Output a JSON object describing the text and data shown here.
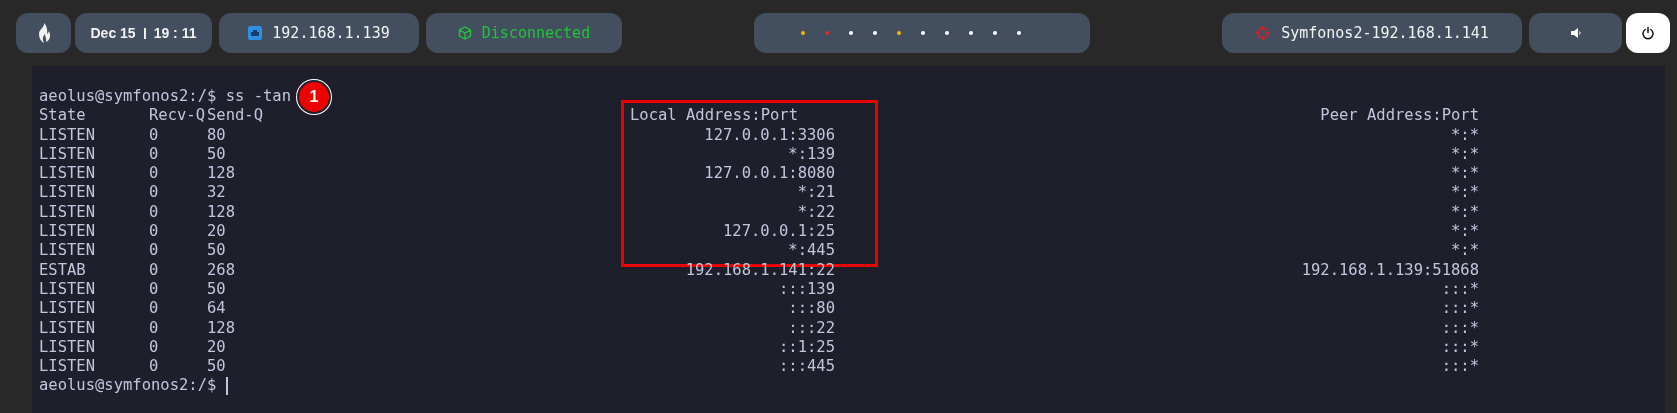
{
  "top_bar": {
    "date": "Dec 15",
    "time": "19 : 11",
    "ip": "192.168.1.139",
    "vpn_status": "Disconnected",
    "workspaces": [
      {
        "color": "#f5b800"
      },
      {
        "color": "#e8262a"
      },
      {
        "color": "#ffffff"
      },
      {
        "color": "#ffffff"
      },
      {
        "color": "#f5b800"
      },
      {
        "color": "#ffffff"
      },
      {
        "color": "#ffffff"
      },
      {
        "color": "#ffffff"
      },
      {
        "color": "#ffffff"
      },
      {
        "color": "#ffffff"
      }
    ],
    "target": "Symfonos2-192.168.1.141"
  },
  "terminal": {
    "prompt": "aeolus@symfonos2:/$ ss -tan",
    "step_badge": "1",
    "header": {
      "state": "State",
      "recv_q": "Recv-Q",
      "send_q": "Send-Q",
      "peer": "Peer Address:Port"
    },
    "local_column": {
      "boxed": [
        "Local Address:Port",
        "127.0.0.1:3306",
        "*:139",
        "127.0.0.1:8080",
        "*:21",
        "*:22",
        "127.0.0.1:25",
        "*:445"
      ],
      "unboxed": [
        "192.168.1.141:22",
        ":::139",
        ":::80",
        ":::22",
        "::1:25",
        ":::445"
      ]
    },
    "rows": [
      {
        "state": "LISTEN",
        "recv_q": "0",
        "send_q": "80",
        "peer": "*:*"
      },
      {
        "state": "LISTEN",
        "recv_q": "0",
        "send_q": "50",
        "peer": "*:*"
      },
      {
        "state": "LISTEN",
        "recv_q": "0",
        "send_q": "128",
        "peer": "*:*"
      },
      {
        "state": "LISTEN",
        "recv_q": "0",
        "send_q": "32",
        "peer": "*:*"
      },
      {
        "state": "LISTEN",
        "recv_q": "0",
        "send_q": "128",
        "peer": "*:*"
      },
      {
        "state": "LISTEN",
        "recv_q": "0",
        "send_q": "20",
        "peer": "*:*"
      },
      {
        "state": "LISTEN",
        "recv_q": "0",
        "send_q": "50",
        "peer": "*:*"
      },
      {
        "state": "ESTAB",
        "recv_q": "0",
        "send_q": "268",
        "peer": "192.168.1.139:51868"
      },
      {
        "state": "LISTEN",
        "recv_q": "0",
        "send_q": "50",
        "peer": ":::*"
      },
      {
        "state": "LISTEN",
        "recv_q": "0",
        "send_q": "64",
        "peer": ":::*"
      },
      {
        "state": "LISTEN",
        "recv_q": "0",
        "send_q": "128",
        "peer": ":::*"
      },
      {
        "state": "LISTEN",
        "recv_q": "0",
        "send_q": "20",
        "peer": ":::*"
      },
      {
        "state": "LISTEN",
        "recv_q": "0",
        "send_q": "50",
        "peer": ":::*"
      }
    ],
    "final_prompt": "aeolus@symfonos2:/$"
  }
}
